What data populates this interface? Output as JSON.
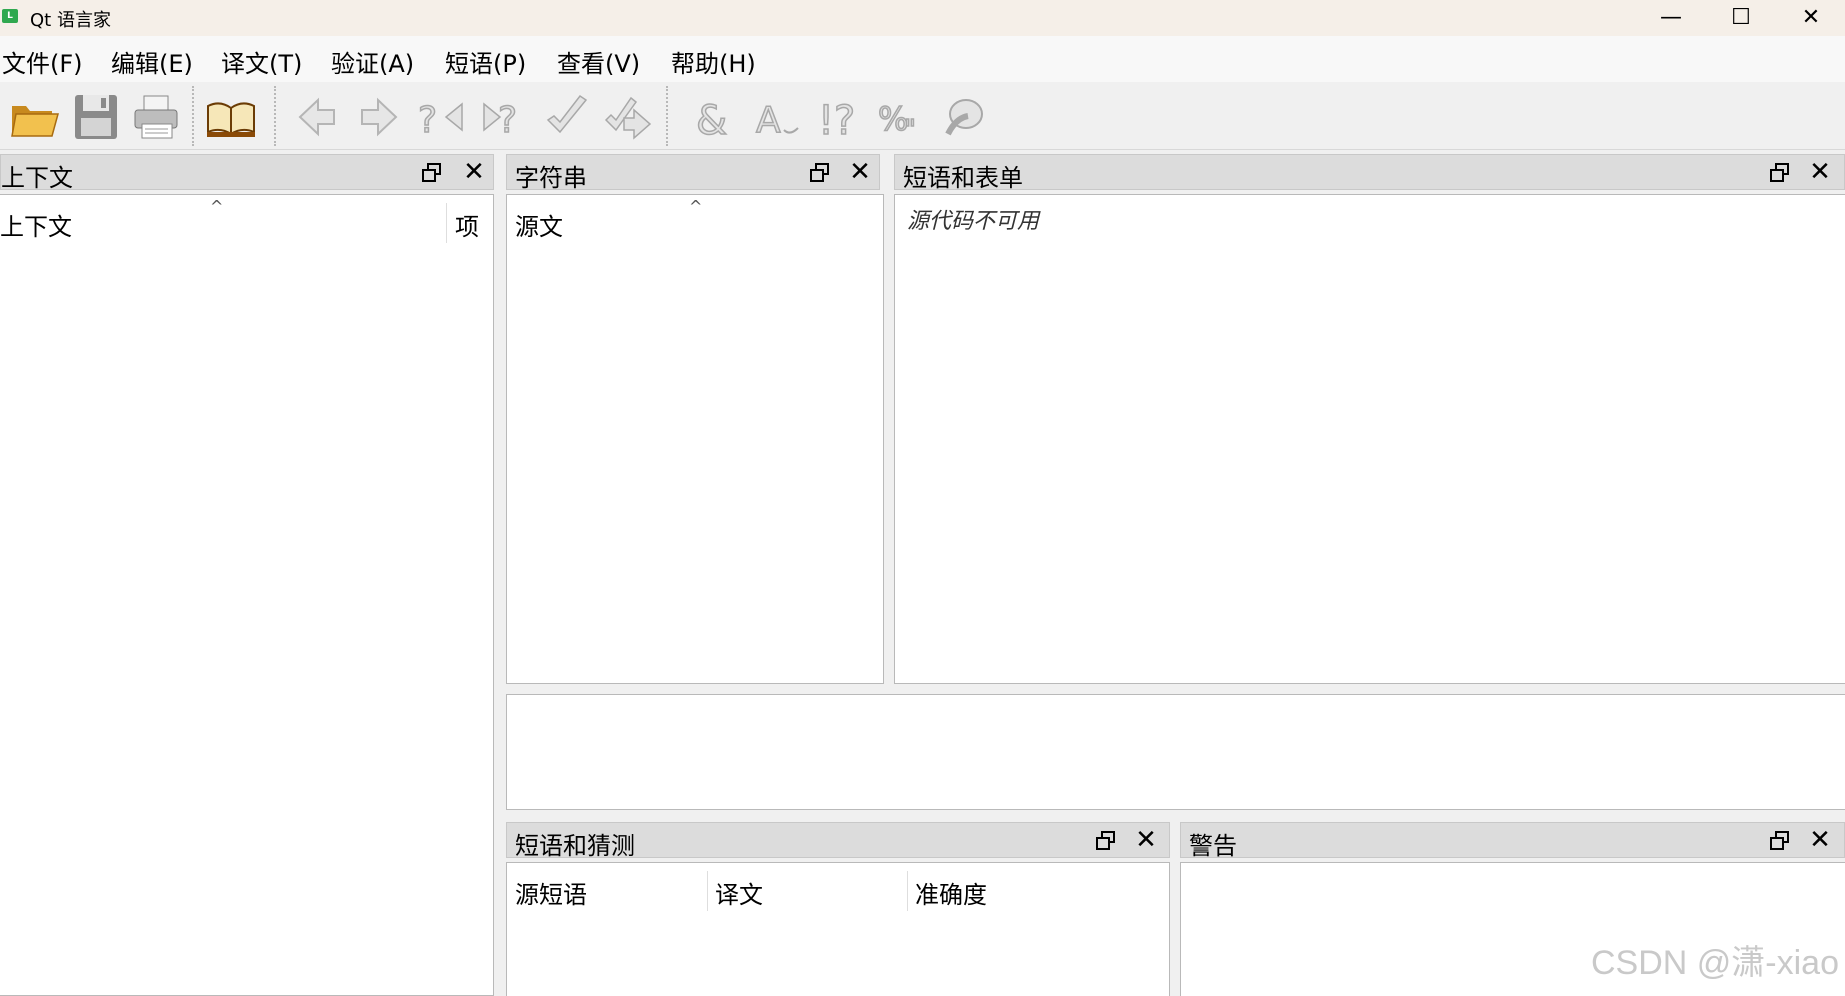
{
  "window": {
    "title": "Qt 语言家",
    "icon_label": "L",
    "controls": {
      "minimize": "—",
      "maximize": "☐",
      "close": "✕"
    }
  },
  "menu": [
    {
      "label": "文件(F)"
    },
    {
      "label": "编辑(E)"
    },
    {
      "label": "译文(T)"
    },
    {
      "label": "验证(A)"
    },
    {
      "label": "短语(P)"
    },
    {
      "label": "查看(V)"
    },
    {
      "label": "帮助(H)"
    }
  ],
  "toolbar": {
    "icons": [
      "open-folder-icon",
      "save-icon",
      "print-icon",
      "phrasebook-book-icon",
      "previous-arrow-icon",
      "next-arrow-icon",
      "prev-unfinished-icon",
      "next-unfinished-icon",
      "done-check-icon",
      "done-and-next-icon",
      "accelerators-ampersand-icon",
      "punctuation-icon",
      "phrase-matches-icon",
      "place-marker-icon",
      "surrounding-whitespace-icon"
    ]
  },
  "context_panel": {
    "title": "上下文",
    "columns": [
      "上下文",
      "项"
    ]
  },
  "strings_panel": {
    "title": "字符串",
    "columns": [
      "源文"
    ]
  },
  "phrases_forms_panel": {
    "title": "短语和表单",
    "placeholder": "源代码不可用"
  },
  "phrases_guesses_panel": {
    "title": "短语和猜测",
    "columns": [
      "源短语",
      "译文",
      "准确度"
    ]
  },
  "warnings_panel": {
    "title": "警告"
  },
  "dock_buttons": {
    "close": "✕"
  },
  "watermark": "CSDN @潇-xiao"
}
